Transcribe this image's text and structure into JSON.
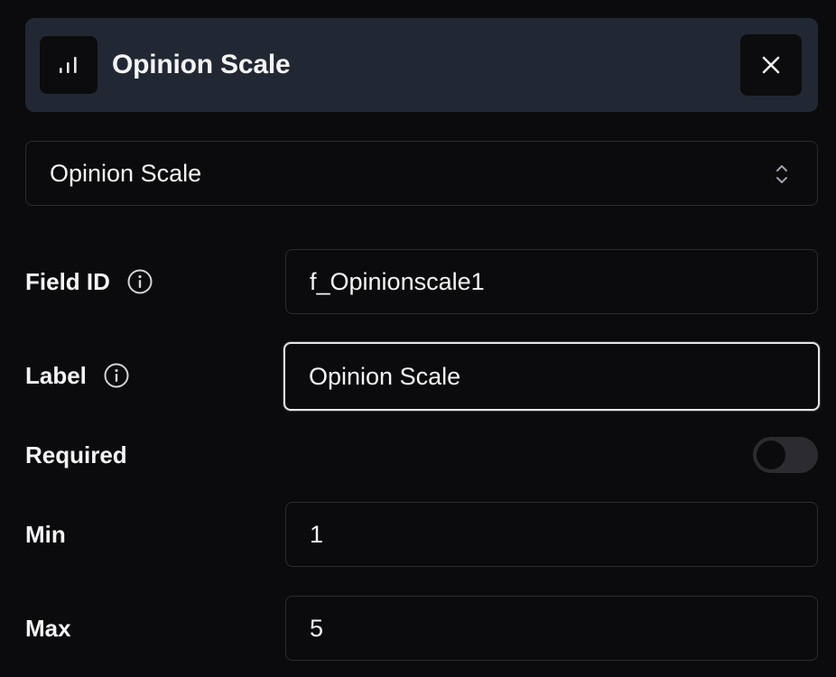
{
  "header": {
    "icon": "bar-chart-icon",
    "title": "Opinion Scale",
    "close_icon": "close-icon"
  },
  "type_select": {
    "value": "Opinion Scale",
    "icon": "chevron-up-down-icon"
  },
  "field_id": {
    "label": "Field ID",
    "value": "f_Opinionscale1"
  },
  "label_field": {
    "label": "Label",
    "value": "Opinion Scale"
  },
  "required": {
    "label": "Required",
    "on": false
  },
  "min": {
    "label": "Min",
    "value": "1"
  },
  "max": {
    "label": "Max",
    "value": "5"
  }
}
